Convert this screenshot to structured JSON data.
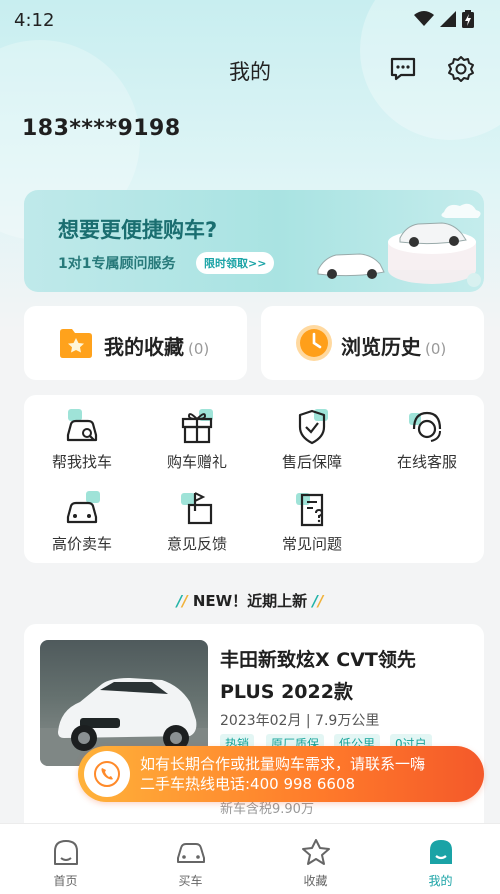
{
  "status_bar": {
    "time": "4:12"
  },
  "header": {
    "title": "我的",
    "message_icon": "message-icon",
    "settings_icon": "gear-icon"
  },
  "user": {
    "phone": "183****9198"
  },
  "banner": {
    "title": "想要更便捷购车?",
    "subtitle": "1对1专属顾问服务",
    "pill": "限时领取>>"
  },
  "shortcuts": {
    "favorites": {
      "label": "我的收藏",
      "count": "(0)"
    },
    "history": {
      "label": "浏览历史",
      "count": "(0)"
    }
  },
  "services": [
    {
      "label": "帮我找车",
      "icon": "find-car-icon"
    },
    {
      "label": "购车赠礼",
      "icon": "gift-icon"
    },
    {
      "label": "售后保障",
      "icon": "shield-icon"
    },
    {
      "label": "在线客服",
      "icon": "headset-icon"
    },
    {
      "label": "高价卖车",
      "icon": "sell-car-icon"
    },
    {
      "label": "意见反馈",
      "icon": "feedback-icon"
    },
    {
      "label": "常见问题",
      "icon": "faq-icon"
    }
  ],
  "new_section": {
    "title": "NEW！近期上新"
  },
  "car": {
    "title": "丰田新致炫X  CVT领先PLUS 2022款",
    "meta": "2023年02月 | 7.9万公里",
    "tags": [
      "热销",
      "原厂质保",
      "低公里",
      "0过户"
    ],
    "price_note": "新车含税9.90万"
  },
  "hotline": {
    "line1": "如有长期合作或批量购车需求，请联系一嗨",
    "line2": "二手车热线电话:400 998 6608"
  },
  "tabbar": {
    "items": [
      {
        "label": "首页",
        "icon": "home-icon"
      },
      {
        "label": "买车",
        "icon": "car-icon"
      },
      {
        "label": "收藏",
        "icon": "star-icon"
      },
      {
        "label": "我的",
        "icon": "profile-icon"
      }
    ],
    "active_index": 3
  },
  "colors": {
    "accent": "#1aa3a6",
    "hotline": "#ff7a2a"
  }
}
